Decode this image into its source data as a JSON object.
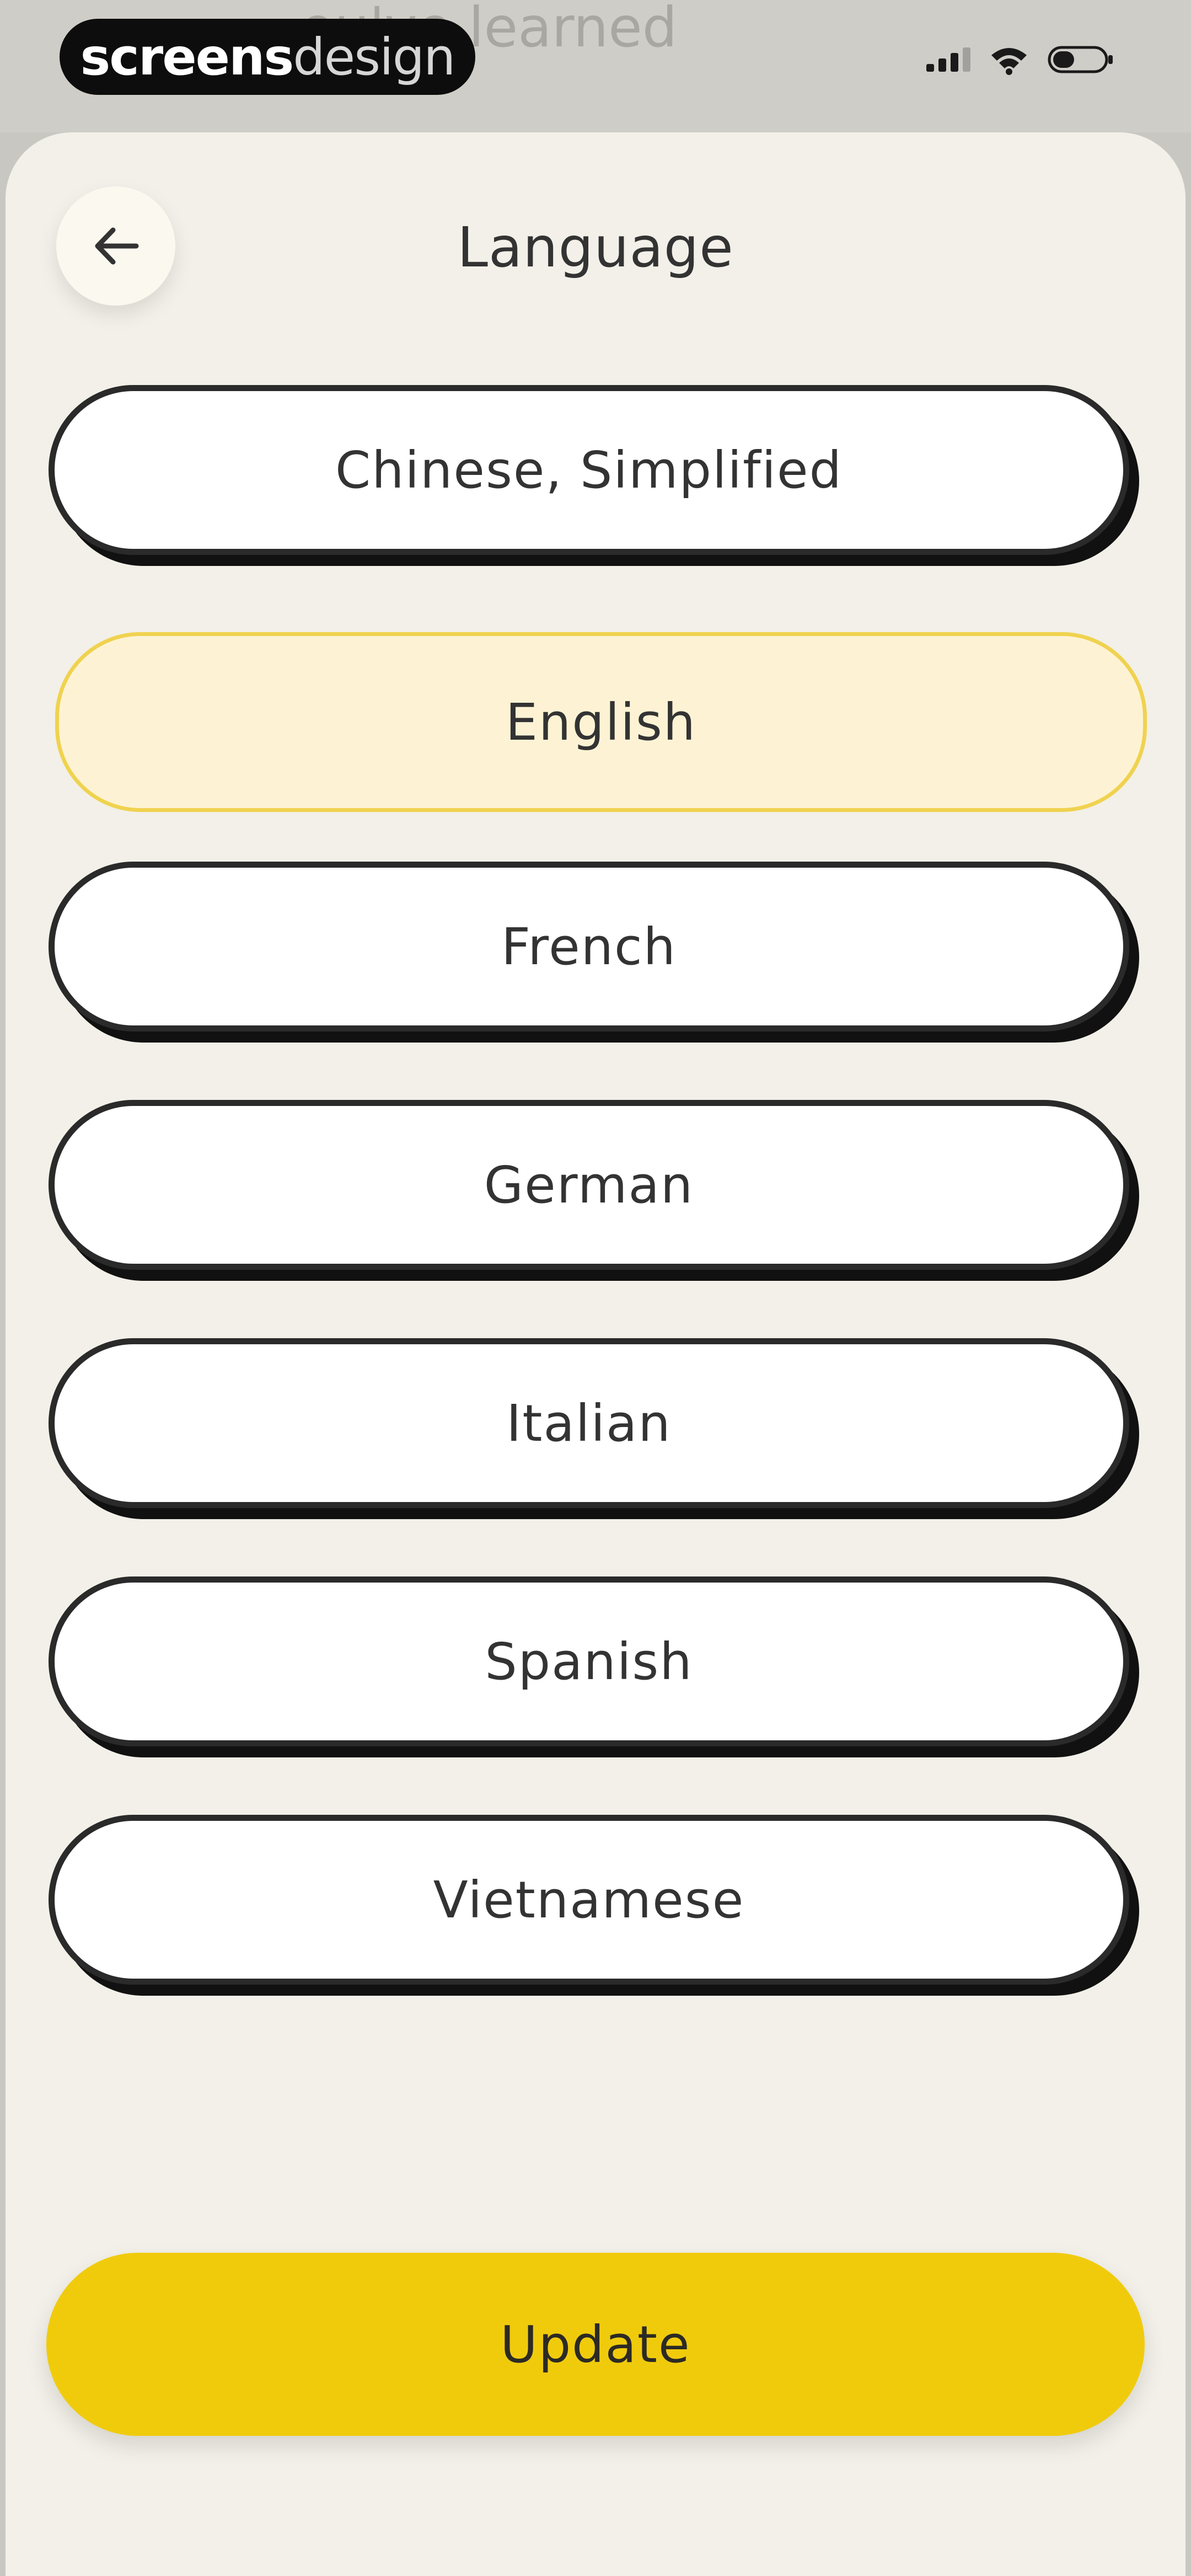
{
  "background": {
    "peek_text": "...ou've learned"
  },
  "watermark": {
    "part1": "screens",
    "part2": "design"
  },
  "status_bar": {
    "icons": [
      "signal-icon",
      "wifi-icon",
      "battery-icon"
    ]
  },
  "header": {
    "back_icon": "arrow-left-icon",
    "title": "Language"
  },
  "languages": [
    {
      "label": "Chinese, Simplified",
      "selected": false
    },
    {
      "label": "English",
      "selected": true
    },
    {
      "label": "French",
      "selected": false
    },
    {
      "label": "German",
      "selected": false
    },
    {
      "label": "Italian",
      "selected": false
    },
    {
      "label": "Spanish",
      "selected": false
    },
    {
      "label": "Vietnamese",
      "selected": false
    }
  ],
  "actions": {
    "update_label": "Update"
  },
  "colors": {
    "accent": "#F0CB0C",
    "selected_background": "#FDF3D4",
    "selected_border": "#F0D24F",
    "sheet_background": "#F2F0E8"
  }
}
